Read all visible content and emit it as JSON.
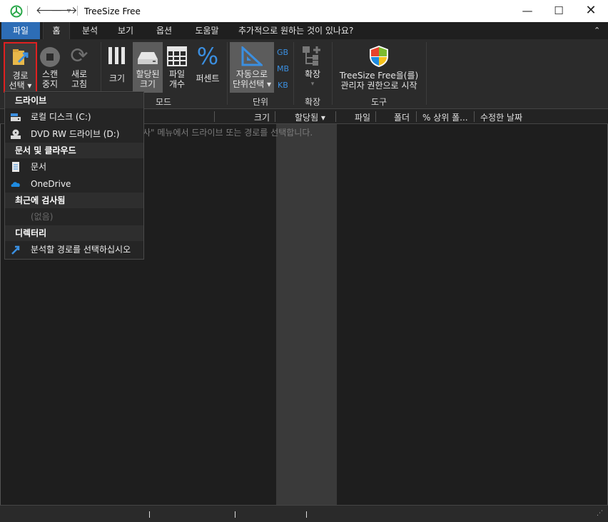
{
  "app": {
    "title": "TreeSize Free"
  },
  "menu": {
    "items": [
      "파일",
      "홈",
      "분석",
      "보기",
      "옵션",
      "도움말",
      "추가적으로 원하는 것이 있나요?"
    ]
  },
  "ribbon": {
    "path_select": [
      "경로",
      "선택 ▾"
    ],
    "scan_stop": [
      "스캔",
      "중지"
    ],
    "refresh": [
      "새로",
      "고침"
    ],
    "size": "크기",
    "allocated": [
      "할당된",
      "크기"
    ],
    "file_count": [
      "파일",
      "개수"
    ],
    "percent": "퍼센트",
    "auto_unit": [
      "자동으로",
      "단위선택 ▾"
    ],
    "gb": "GB",
    "mb": "MB",
    "kb": "KB",
    "expand": "확장",
    "admin": [
      "TreeSize Free을(를)",
      "관리자 권한으로 시작"
    ],
    "group_mode": "모드",
    "group_unit": "단위",
    "group_expand": "확장",
    "group_tools": "도구"
  },
  "columns": [
    "크기",
    "할당됨 ▾",
    "파일",
    "폴더",
    "% 상위 폴...",
    "수정한 날짜"
  ],
  "hint": "사\" 메뉴에서 드라이브 또는 경로를 선택합니다.",
  "dropdown": {
    "drives_header": "드라이브",
    "local_disk": "로컬 디스크 (C:)",
    "dvd": "DVD RW 드라이브 (D:)",
    "docs_header": "문서 및 클라우드",
    "documents": "문서",
    "onedrive": "OneDrive",
    "recent_header": "최근에 검사됨",
    "empty": "(없음)",
    "dir_header": "디렉터리",
    "choose_path": "분석할 경로를 선택하십시오"
  },
  "colors": {
    "accent": "#2d6db6",
    "highlight_border": "#e02020"
  }
}
